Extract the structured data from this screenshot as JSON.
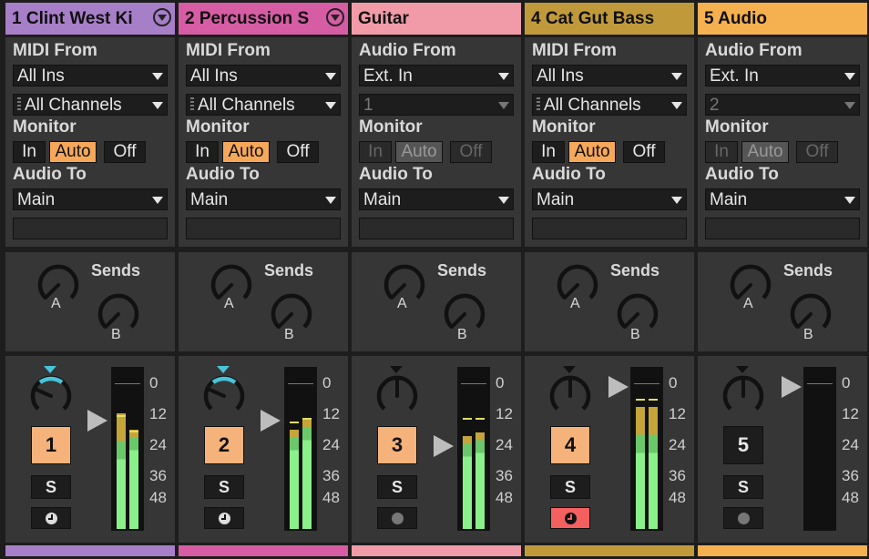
{
  "tracks": [
    {
      "id": "t1",
      "name": "1 Clint West Ki",
      "color": "#a77ec8",
      "fold": true,
      "input_label": "MIDI From",
      "input_source": "All Ins",
      "channel": "All Channels",
      "channel_grip": true,
      "channel_dim": false,
      "monitor": {
        "in": "In",
        "auto": "Auto",
        "off": "Off",
        "active": "auto",
        "disabled": false
      },
      "output_label": "Audio To",
      "output": "Main",
      "sends_label": "Sends",
      "send_a": "A",
      "send_b": "B",
      "pan_style": "cyan",
      "track_number": "1",
      "track_active": true,
      "solo": "S",
      "arm": "clock",
      "arm_armed": false,
      "meter": {
        "left": 0.72,
        "right": 0.62,
        "left_peak": 0.7,
        "right_peak": 0.6
      },
      "fader_level": 0.78,
      "scale": [
        "0",
        "12",
        "24",
        "36",
        "48"
      ]
    },
    {
      "id": "t2",
      "name": "2 Percussion S",
      "color": "#d65ca4",
      "fold": true,
      "input_label": "MIDI From",
      "input_source": "All Ins",
      "channel": "All Channels",
      "channel_grip": true,
      "channel_dim": false,
      "monitor": {
        "in": "In",
        "auto": "Auto",
        "off": "Off",
        "active": "auto",
        "disabled": false
      },
      "output_label": "Audio To",
      "output": "Main",
      "sends_label": "Sends",
      "send_a": "A",
      "send_b": "B",
      "pan_style": "cyan",
      "track_number": "2",
      "track_active": true,
      "solo": "S",
      "arm": "clock",
      "arm_armed": false,
      "meter": {
        "left": 0.62,
        "right": 0.68,
        "left_peak": 0.66,
        "right_peak": 0.68
      },
      "fader_level": 0.78,
      "scale": [
        "0",
        "12",
        "24",
        "36",
        "48"
      ]
    },
    {
      "id": "t3",
      "name": "Guitar",
      "color": "#f19ba8",
      "fold": false,
      "input_label": "Audio From",
      "input_source": "Ext. In",
      "channel": "1",
      "channel_grip": false,
      "channel_dim": true,
      "monitor": {
        "in": "In",
        "auto": "Auto",
        "off": "Off",
        "active": "auto",
        "disabled": true
      },
      "output_label": "Audio To",
      "output": "Main",
      "sends_label": "Sends",
      "send_a": "A",
      "send_b": "B",
      "pan_style": "plain",
      "track_number": "3",
      "track_active": true,
      "solo": "S",
      "arm": "dot",
      "arm_armed": false,
      "meter": {
        "left": 0.58,
        "right": 0.6,
        "left_peak": 0.68,
        "right_peak": 0.68
      },
      "fader_level": 0.7,
      "scale": [
        "0",
        "12",
        "24",
        "36",
        "48"
      ]
    },
    {
      "id": "t4",
      "name": "4 Cat Gut Bass",
      "color": "#c09a3a",
      "fold": false,
      "input_label": "MIDI From",
      "input_source": "All Ins",
      "channel": "All Channels",
      "channel_grip": true,
      "channel_dim": false,
      "monitor": {
        "in": "In",
        "auto": "Auto",
        "off": "Off",
        "active": "auto",
        "disabled": false
      },
      "output_label": "Audio To",
      "output": "Main",
      "sends_label": "Sends",
      "send_a": "A",
      "send_b": "B",
      "pan_style": "plain",
      "track_number": "4",
      "track_active": true,
      "solo": "S",
      "arm": "clock",
      "arm_armed": true,
      "meter": {
        "left": 0.76,
        "right": 0.76,
        "left_peak": 0.8,
        "right_peak": 0.8
      },
      "fader_level": 0.89,
      "scale": [
        "0",
        "12",
        "24",
        "36",
        "48"
      ]
    },
    {
      "id": "t5",
      "name": "5 Audio",
      "color": "#f5b050",
      "fold": false,
      "input_label": "Audio From",
      "input_source": "Ext. In",
      "channel": "2",
      "channel_grip": false,
      "channel_dim": true,
      "monitor": {
        "in": "In",
        "auto": "Auto",
        "off": "Off",
        "active": "auto",
        "disabled": true
      },
      "output_label": "Audio To",
      "output": "Main",
      "sends_label": "Sends",
      "send_a": "A",
      "send_b": "B",
      "pan_style": "plain",
      "track_number": "5",
      "track_active": false,
      "solo": "S",
      "arm": "dot",
      "arm_armed": false,
      "meter": {
        "left": 0,
        "right": 0,
        "left_peak": 0,
        "right_peak": 0
      },
      "fader_level": 0.89,
      "scale": [
        "0",
        "12",
        "24",
        "36",
        "48"
      ]
    }
  ]
}
